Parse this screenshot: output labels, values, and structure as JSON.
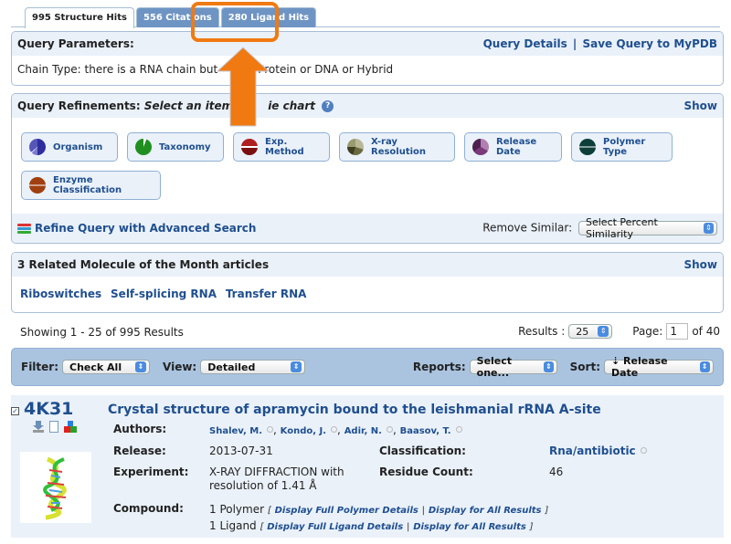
{
  "tabs": [
    {
      "label": "995 Structure Hits",
      "active": true
    },
    {
      "label": "556 Citations",
      "active": false
    },
    {
      "label": "280 Ligand Hits",
      "active": false,
      "highlighted": true
    }
  ],
  "query_params": {
    "title": "Query Parameters:",
    "details_link": "Query Details",
    "separator": "|",
    "save_link": "Save Query to MyPDB",
    "text_before": "Chain Type: there is a RNA chain but",
    "text_after": "Protein or DNA or Hybrid"
  },
  "refinements": {
    "title": "Query Refinements:",
    "subtitle_before": "Select an item",
    "subtitle_after": "ie chart",
    "help_icon": "question-circle-icon",
    "show_label": "Show",
    "buttons": [
      {
        "label": "Organism",
        "color": "#2e2e9e",
        "icon": "pie-chart-icon"
      },
      {
        "label": "Taxonomy",
        "color": "#1f8f1f",
        "icon": "pie-chart-icon"
      },
      {
        "label": "Exp. Method",
        "color": "#8f1a1a",
        "icon": "pie-chart-icon"
      },
      {
        "label": "X-ray Resolution",
        "color": "#8a8a60",
        "icon": "pie-chart-icon"
      },
      {
        "label": "Release Date",
        "color": "#7a3a7a",
        "icon": "pie-chart-icon"
      },
      {
        "label": "Polymer Type",
        "color": "#0e3e3a",
        "icon": "pie-chart-icon"
      },
      {
        "label": "Enzyme Classification",
        "color": "#a04010",
        "icon": "pie-chart-icon"
      }
    ],
    "advanced_link": "Refine Query with Advanced Search",
    "remove_similar_label": "Remove Similar:",
    "remove_similar_value": "Select Percent Similarity"
  },
  "motm": {
    "title": "3 Related Molecule of the Month articles",
    "show_label": "Show",
    "links": [
      "Riboswitches",
      "Self-splicing RNA",
      "Transfer RNA"
    ]
  },
  "pagination": {
    "showing": "Showing 1 - 25 of 995 Results",
    "results_label": "Results :",
    "results_value": "25",
    "page_label": "Page:",
    "page_value": "1",
    "of_label": "of 40"
  },
  "filter_bar": {
    "filter_label": "Filter:",
    "filter_value": "Check All",
    "view_label": "View:",
    "view_value": "Detailed",
    "reports_label": "Reports:",
    "reports_value": "Select one...",
    "sort_label": "Sort:",
    "sort_value": "⇣ Release Date"
  },
  "result": {
    "checked": true,
    "pdb_id": "4K31",
    "title": "Crystal structure of apramycin bound to the leishmanial rRNA A-site",
    "authors_label": "Authors:",
    "authors": [
      "Shalev, M.",
      "Kondo, J.",
      "Adir, N.",
      "Baasov, T."
    ],
    "release_label": "Release:",
    "release_value": "2013-07-31",
    "classification_label": "Classification:",
    "classification_value": "Rna/antibiotic",
    "experiment_label": "Experiment:",
    "experiment_line1": "X-RAY DIFFRACTION with",
    "experiment_line2": "resolution of 1.41 Å",
    "residue_label": "Residue Count:",
    "residue_value": "46",
    "compound_label": "Compound:",
    "polymer_text": "1 Polymer",
    "polymer_details_link": "Display Full Polymer Details",
    "ligand_text": "1 Ligand",
    "ligand_details_link": "Display Full Ligand Details",
    "all_results_link": "Display for All Results",
    "bracket_open": "[",
    "bracket_close": "]",
    "bracket_sep": "|"
  },
  "annotation": {
    "color": "#f07a11"
  }
}
